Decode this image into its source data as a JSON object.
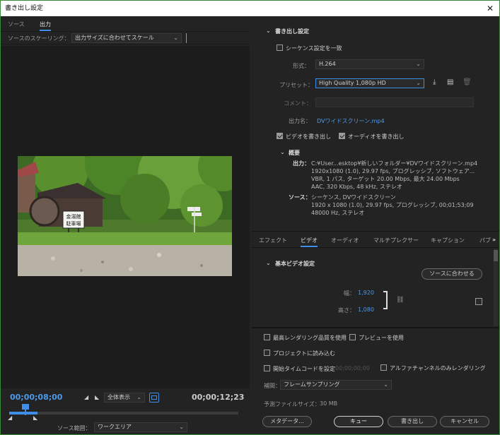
{
  "window": {
    "title": "書き出し設定",
    "close": "✕"
  },
  "left": {
    "tabs": [
      "ソース",
      "出力"
    ],
    "scaling_label": "ソースのスケーリング：",
    "scaling_value": "出力サイズに合わせてスケール",
    "timecode_current": "00;00;08;00",
    "timecode_end": "00;00;12;23",
    "zoom_value": "全体表示",
    "range_label": "ソース範囲：",
    "range_value": "ワークエリア",
    "photo_sign_line1": "金湯館",
    "photo_sign_line2": "駐車場"
  },
  "export": {
    "header": "書き出し設定",
    "match_sequence": "シーケンス設定を一致",
    "format_label": "形式：",
    "format_value": "H.264",
    "preset_label": "プリセット：",
    "preset_value": "High Quality 1,080p HD",
    "comment_label": "コメント：",
    "output_label": "出力名：",
    "output_value": "DVワイドスクリーン.mp4",
    "export_video": "ビデオを書き出し",
    "export_audio": "オーディオを書き出し",
    "summary_header": "概要",
    "output_key": "出力：",
    "output_lines": [
      "C:¥User...esktop¥新しいフォルダー¥DVワイドスクリーン.mp4",
      "1920x1080 (1.0), 29.97 fps, プログレッシブ, ソフトウェア...",
      "VBR, 1 パス, ターゲット 20.00 Mbps, 最大 24.00 Mbps",
      "AAC, 320 Kbps, 48 kHz, ステレオ"
    ],
    "source_key": "ソース：",
    "source_lines": [
      "シーケンス, DVワイドスクリーン",
      "1920 x 1080 (1.0), 29.97 fps, プログレッシブ, 00;01;53;09",
      "48000 Hz, ステレオ"
    ]
  },
  "video_tabs": [
    "エフェクト",
    "ビデオ",
    "オーディオ",
    "マルチプレクサー",
    "キャプション",
    "パブ"
  ],
  "video": {
    "section_header": "基本ビデオ設定",
    "match_source_button": "ソースに合わせる",
    "width_label": "幅：",
    "width_value": "1,920",
    "height_label": "高さ：",
    "height_value": "1,080"
  },
  "bottom": {
    "max_render": "最高レンダリング品質を使用",
    "use_preview": "プレビューを使用",
    "import_project": "プロジェクトに読み込む",
    "start_timecode": "開始タイムコードを設定",
    "start_timecode_value": "00;00;00;00",
    "alpha_only": "アルファチャンネルのみレンダリング",
    "interp_label": "補間：",
    "interp_value": "フレームサンプリング",
    "filesize_label": "予測ファイルサイズ：",
    "filesize_value": "30 MB",
    "metadata_button": "メタデータ...",
    "queue_button": "キュー",
    "export_button": "書き出し",
    "cancel_button": "キャンセル"
  },
  "colors": {
    "accent": "#3f8fe8",
    "link": "#4e9ae8",
    "panel": "#232323",
    "border": "#3a8a3a"
  }
}
